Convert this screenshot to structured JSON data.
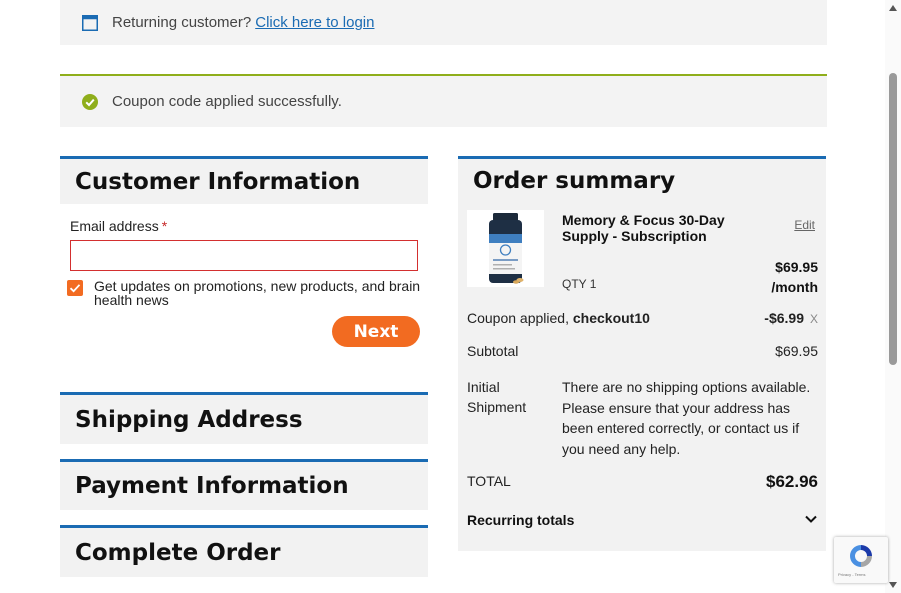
{
  "login_notice": {
    "prompt": "Returning customer?",
    "link": "Click here to login"
  },
  "success_notice": {
    "message": "Coupon code applied successfully."
  },
  "customer_info": {
    "heading": "Customer Information",
    "email_label": "Email address",
    "required_mark": "*",
    "email_value": "",
    "opt_in_label": "Get updates on promotions, new products, and brain health news",
    "opt_in_checked": true,
    "next_label": "Next"
  },
  "sections": {
    "shipping": "Shipping Address",
    "payment": "Payment Information",
    "complete": "Complete Order"
  },
  "order_summary": {
    "title": "Order summary",
    "product": {
      "name": "Memory & Focus 30-Day Supply - Subscription",
      "edit": "Edit",
      "price": "$69.95",
      "period": "/month",
      "qty": "QTY 1"
    },
    "coupon": {
      "label": "Coupon applied,",
      "code": "checkout10",
      "amount": "-$6.99",
      "remove": "X"
    },
    "subtotal": {
      "label": "Subtotal",
      "value": "$69.95"
    },
    "shipment": {
      "label": "Initial Shipment",
      "message": "There are no shipping options available. Please ensure that your address has been entered correctly, or contact us if you need any help."
    },
    "total": {
      "label": "TOTAL",
      "value": "$62.96"
    },
    "recurring": {
      "label": "Recurring totals"
    }
  },
  "recaptcha": {
    "text": "Privacy - Terms"
  },
  "colors": {
    "accent_blue": "#1a6bb3",
    "accent_orange": "#f26b21",
    "success_green": "#8fae1b",
    "error_red": "#d32f2f"
  }
}
